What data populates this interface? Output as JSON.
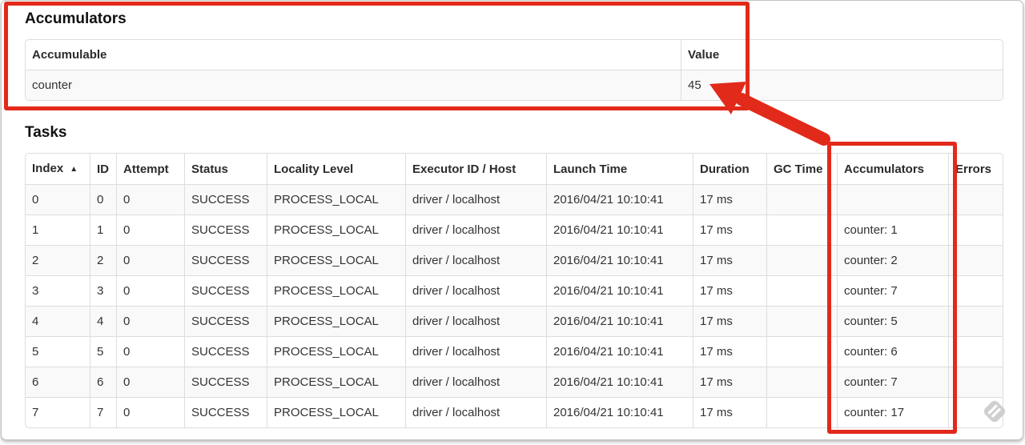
{
  "accumulators_section": {
    "title": "Accumulators",
    "table": {
      "headers": [
        "Accumulable",
        "Value"
      ],
      "rows": [
        [
          "counter",
          "45"
        ]
      ]
    }
  },
  "tasks_section": {
    "title": "Tasks",
    "sort_indicator": "▲",
    "table": {
      "headers": [
        "Index",
        "ID",
        "Attempt",
        "Status",
        "Locality Level",
        "Executor ID / Host",
        "Launch Time",
        "Duration",
        "GC Time",
        "Accumulators",
        "Errors"
      ],
      "rows": [
        [
          "0",
          "0",
          "0",
          "SUCCESS",
          "PROCESS_LOCAL",
          "driver / localhost",
          "2016/04/21 10:10:41",
          "17 ms",
          "",
          "",
          ""
        ],
        [
          "1",
          "1",
          "0",
          "SUCCESS",
          "PROCESS_LOCAL",
          "driver / localhost",
          "2016/04/21 10:10:41",
          "17 ms",
          "",
          "counter: 1",
          ""
        ],
        [
          "2",
          "2",
          "0",
          "SUCCESS",
          "PROCESS_LOCAL",
          "driver / localhost",
          "2016/04/21 10:10:41",
          "17 ms",
          "",
          "counter: 2",
          ""
        ],
        [
          "3",
          "3",
          "0",
          "SUCCESS",
          "PROCESS_LOCAL",
          "driver / localhost",
          "2016/04/21 10:10:41",
          "17 ms",
          "",
          "counter: 7",
          ""
        ],
        [
          "4",
          "4",
          "0",
          "SUCCESS",
          "PROCESS_LOCAL",
          "driver / localhost",
          "2016/04/21 10:10:41",
          "17 ms",
          "",
          "counter: 5",
          ""
        ],
        [
          "5",
          "5",
          "0",
          "SUCCESS",
          "PROCESS_LOCAL",
          "driver / localhost",
          "2016/04/21 10:10:41",
          "17 ms",
          "",
          "counter: 6",
          ""
        ],
        [
          "6",
          "6",
          "0",
          "SUCCESS",
          "PROCESS_LOCAL",
          "driver / localhost",
          "2016/04/21 10:10:41",
          "17 ms",
          "",
          "counter: 7",
          ""
        ],
        [
          "7",
          "7",
          "0",
          "SUCCESS",
          "PROCESS_LOCAL",
          "driver / localhost",
          "2016/04/21 10:10:41",
          "17 ms",
          "",
          "counter: 17",
          ""
        ]
      ]
    }
  },
  "annotations": {
    "accent_color": "#e22a1a"
  }
}
